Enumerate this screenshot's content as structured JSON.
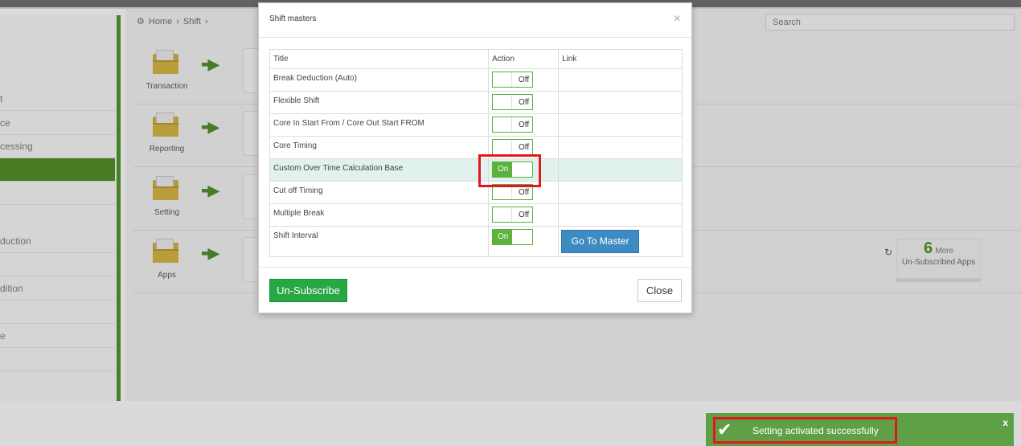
{
  "background": {
    "breadcrumb": [
      "Home",
      "Shift"
    ],
    "search_placeholder": "Search",
    "sidebar_items": [
      {
        "label": "t"
      },
      {
        "label": "ce"
      },
      {
        "label": "cessing"
      },
      {
        "label": ""
      },
      {
        "label": ""
      },
      {
        "label": "duction"
      },
      {
        "label": ""
      },
      {
        "label": "dition"
      },
      {
        "label": ""
      },
      {
        "label": "e"
      },
      {
        "label": ""
      }
    ],
    "flow_rows": [
      {
        "label": "Transaction"
      },
      {
        "label": "Reporting"
      },
      {
        "label": "Setting"
      },
      {
        "label": "Apps"
      }
    ],
    "more_apps": {
      "count": "6",
      "word": "More",
      "subtitle": "Un-Subscribed Apps"
    }
  },
  "modal": {
    "title": "Shift masters",
    "columns": {
      "title": "Title",
      "action": "Action",
      "link": "Link"
    },
    "rows": [
      {
        "title": "Break Deduction (Auto)",
        "state": "Off"
      },
      {
        "title": "Flexible Shift",
        "state": "Off"
      },
      {
        "title": "Core In Start From / Core Out Start FROM",
        "state": "Off"
      },
      {
        "title": "Core Timing",
        "state": "Off"
      },
      {
        "title": "Custom Over Time Calculation Base",
        "state": "On"
      },
      {
        "title": "Cut off Timing",
        "state": "Off"
      },
      {
        "title": "Multiple Break",
        "state": "Off"
      },
      {
        "title": "Shift Interval",
        "state": "On",
        "link": "Go To Master"
      }
    ],
    "unsubscribe_label": "Un-Subscribe",
    "close_label": "Close"
  },
  "toast": {
    "message": "Setting activated successfully",
    "close": "x"
  },
  "colors": {
    "accent_green": "#5bb33e",
    "button_blue": "#3e8bc4",
    "highlight_red": "#e0191e"
  }
}
